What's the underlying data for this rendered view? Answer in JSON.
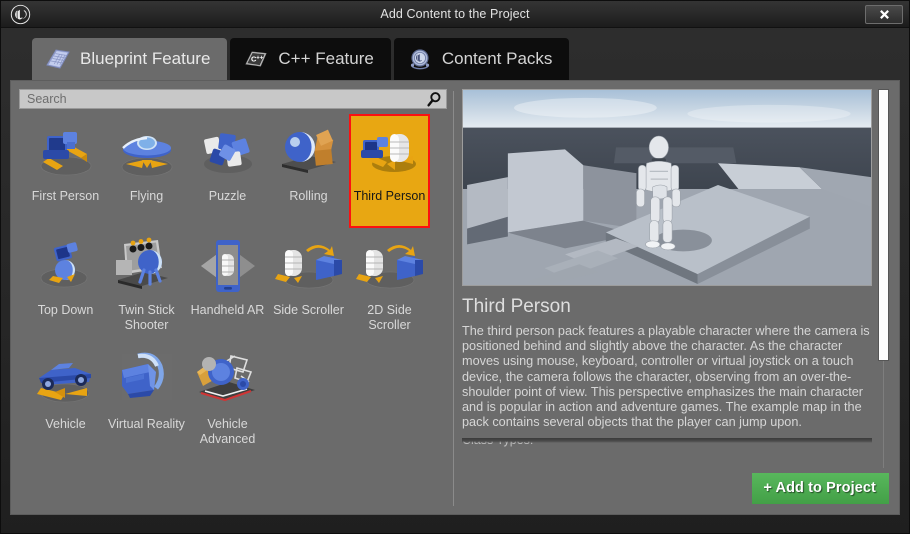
{
  "window": {
    "title": "Add Content to the Project",
    "logo_icon": "unreal-engine-logo",
    "close_icon": "close-icon",
    "close_label": "✕"
  },
  "tabs": [
    {
      "label": "Blueprint Feature",
      "icon": "blueprint-book-icon",
      "active": true
    },
    {
      "label": "C++ Feature",
      "icon": "cpp-icon",
      "active": false
    },
    {
      "label": "Content Packs",
      "icon": "unreal-orb-icon",
      "active": false
    }
  ],
  "search": {
    "placeholder": "Search",
    "value": "",
    "icon": "search-icon"
  },
  "templates": [
    {
      "label": "First Person",
      "icon": "first-person-icon",
      "selected": false
    },
    {
      "label": "Flying",
      "icon": "flying-icon",
      "selected": false
    },
    {
      "label": "Puzzle",
      "icon": "puzzle-icon",
      "selected": false
    },
    {
      "label": "Rolling",
      "icon": "rolling-icon",
      "selected": false
    },
    {
      "label": "Third Person",
      "icon": "third-person-icon",
      "selected": true
    },
    {
      "label": "Top Down",
      "icon": "top-down-icon",
      "selected": false
    },
    {
      "label": "Twin Stick Shooter",
      "icon": "twin-stick-shooter-icon",
      "selected": false
    },
    {
      "label": "Handheld AR",
      "icon": "handheld-ar-icon",
      "selected": false
    },
    {
      "label": "Side Scroller",
      "icon": "side-scroller-icon",
      "selected": false
    },
    {
      "label": "2D Side Scroller",
      "icon": "2d-side-scroller-icon",
      "selected": false
    },
    {
      "label": "Vehicle",
      "icon": "vehicle-icon",
      "selected": false
    },
    {
      "label": "Virtual Reality",
      "icon": "virtual-reality-icon",
      "selected": false
    },
    {
      "label": "Vehicle Advanced",
      "icon": "vehicle-advanced-icon",
      "selected": false
    }
  ],
  "detail": {
    "preview_alt": "third-person-template-preview",
    "title": "Third Person",
    "description": "The third person pack features a playable character where the camera is positioned behind and slightly above the character. As the character moves using mouse, keyboard, controller or virtual joystick on a touch device, the camera follows the character, observing from an over-the-shoulder point of view. This perspective emphasizes the main character and is popular in action and adventure games. The example map in the pack contains several objects that the player can jump upon.",
    "clipped_line": "Class Types:"
  },
  "footer": {
    "add_label": "+ Add to Project"
  },
  "colors": {
    "accent_selected_bg": "#e8a712",
    "accent_selected_border": "#fb1111",
    "add_button": "#4caf50",
    "panel_bg": "#6b6b6b",
    "tab_inactive": "#0d0d0d"
  }
}
